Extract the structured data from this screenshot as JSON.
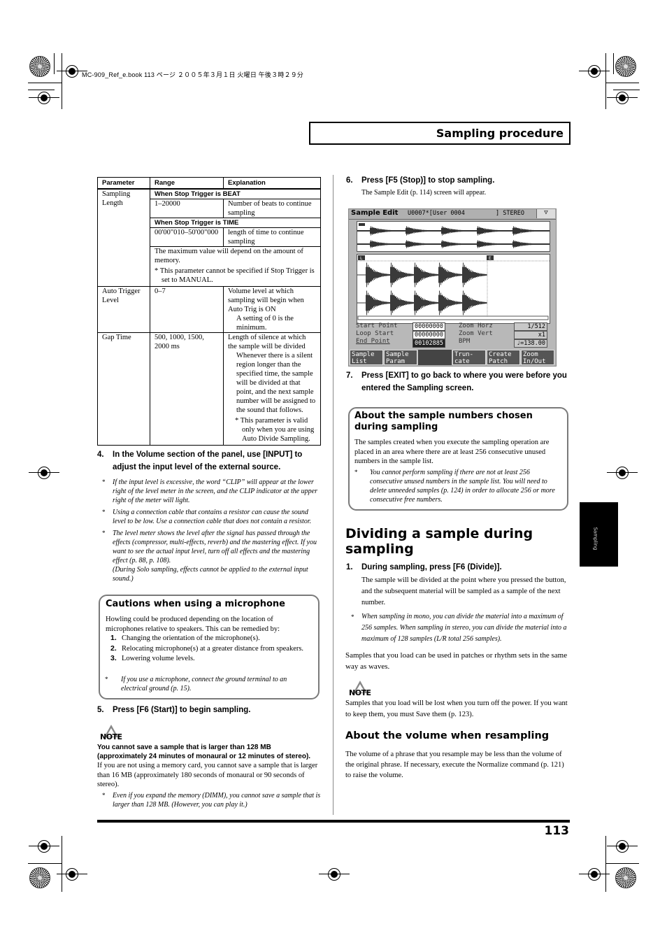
{
  "slug": "MC-909_Ref_e.book  113 ページ  ２００５年３月１日  火曜日  午後３時２９分",
  "header": {
    "title": "Sampling procedure"
  },
  "table": {
    "headers": [
      "Parameter",
      "Range",
      "Explanation"
    ],
    "sampling_length": {
      "param": "Sampling Length",
      "beat_heading": "When Stop Trigger is BEAT",
      "beat_range": "1–20000",
      "beat_expl": "Number of beats to continue sampling",
      "time_heading": "When Stop Trigger is TIME",
      "time_range": "00'00\"010–50'00\"000",
      "time_expl": "length of time to continue sampling",
      "max_note": "The maximum value will depend on the amount of memory.",
      "star_note": "This parameter cannot be specified if Stop Trigger is set to MANUAL."
    },
    "auto_trigger": {
      "param": "Auto Trigger Level",
      "range": "0–7",
      "expl": "Volume level at which sampling will begin when Auto Trig is ON",
      "sub": "A setting of 0 is the minimum."
    },
    "gap_time": {
      "param": "Gap Time",
      "range": "500, 1000, 1500, 2000 ms",
      "expl": "Length of silence at which the sample will be divided",
      "sub": "Whenever there is a silent region longer than the specified time, the sample will be divided at that point, and the next sample number will be assigned to the sound that follows.",
      "star_note": "This parameter is valid only when you are using Auto Divide Sampling."
    }
  },
  "left": {
    "step4": {
      "num": "4.",
      "text": "In the Volume section of the panel, use [INPUT] to adjust the input level of the external source."
    },
    "step4_notes": [
      "If the input level is excessive, the word “CLIP” will appear at the lower right of the level meter in the screen, and the CLIP indicator at the upper right of the meter will light.",
      "Using a connection cable that contains a resistor can cause the sound level to be low. Use a connection cable that does not contain a resistor.",
      "The level meter shows the level after the signal has passed through the effects (compressor, multi-effects, reverb) and the mastering effect. If you want to see the actual input level, turn off all effects and the mastering effect (p. 88, p. 108).",
      "(During Solo sampling, effects cannot be applied to the external input sound.)"
    ],
    "mic_box": {
      "title": "Cautions when using a microphone",
      "intro": "Howling could be produced depending on the location of microphones relative to speakers. This can be remedied by:",
      "items": [
        {
          "num": "1.",
          "text": "Changing the orientation of the microphone(s)."
        },
        {
          "num": "2.",
          "text": "Relocating microphone(s) at a greater distance from speakers."
        },
        {
          "num": "3.",
          "text": "Lowering volume levels."
        }
      ],
      "note": "If you use a microphone, connect the ground terminal to an electrical ground (p. 15)."
    },
    "step5": {
      "num": "5.",
      "text": "Press [F6 (Start)] to begin sampling."
    },
    "note": {
      "label": "NOTE",
      "bold": "You cannot save a sample that is larger than 128 MB (approximately 24 minutes of monaural or 12 minutes of stereo).",
      "text": "If you are not using a memory card, you cannot save a sample that is larger than 16 MB (approximately 180 seconds of monaural or 90 seconds of stereo).",
      "star": "Even if you expand the memory (DIMM), you cannot save a sample that is larger than 128 MB. (However, you can play it.)"
    }
  },
  "right": {
    "step6": {
      "num": "6.",
      "text": "Press [F5 (Stop)] to stop sampling.",
      "sub": "The Sample Edit (p. 114) screen will appear."
    },
    "lcd": {
      "title": "Sample Edit",
      "sample": "U0007*[User 0004",
      "mode": "] STEREO",
      "fields": [
        {
          "label": "Start Point",
          "value": "00000000"
        },
        {
          "label": "Loop Start",
          "value": "00000000"
        },
        {
          "label": "End Point",
          "value": "00102885"
        }
      ],
      "right_fields": [
        {
          "label": "Zoom Horz",
          "value": "1/512"
        },
        {
          "label": "Zoom Vert",
          "value": "x1"
        },
        {
          "label": "BPM",
          "value": "♩=138.00"
        }
      ],
      "fkeys": [
        "Sample List",
        "Sample Param",
        "",
        "Trun-cate",
        "Create Patch",
        "Zoom In/Out"
      ],
      "marker_l": "L",
      "marker_e": "E"
    },
    "step7": {
      "num": "7.",
      "text": "Press [EXIT] to go back to where you were before you entered the Sampling screen."
    },
    "numbers_box": {
      "title": "About the sample numbers chosen during sampling",
      "text": "The samples created when you execute the sampling operation are placed in an area where there are at least 256 consecutive unused numbers in the sample list.",
      "note": "You cannot perform sampling if there are not at least 256 consecutive unused numbers in the sample list. You will need to delete unneeded samples (p. 124) in order to allocate 256 or more consecutive free numbers."
    },
    "divide_heading": "Dividing a sample during sampling",
    "step1": {
      "num": "1.",
      "text": "During sampling, press [F6 (Divide)].",
      "sub": "The sample will be divided at the point where you pressed the button, and the subsequent material will be sampled as a sample of the next number."
    },
    "step1_note": "When sampling in mono, you can divide the material into a maximum of 256 samples. When sampling in stereo, you can divide the material into a maximum of 128 samples (L/R total 256 samples).",
    "load_text": "Samples that you load can be used in patches or rhythm sets in the same way as waves.",
    "note": {
      "label": "NOTE",
      "text": "Samples that you load will be lost when you turn off the power. If you want to keep them, you must Save them (p. 123)."
    },
    "volume_heading": "About the volume when resampling",
    "volume_text": "The volume of a phrase that you resample may be less than the volume of the original phrase. If necessary, execute the Normalize command (p. 121) to raise the volume."
  },
  "side_tab": "Sampling",
  "page_number": "113"
}
